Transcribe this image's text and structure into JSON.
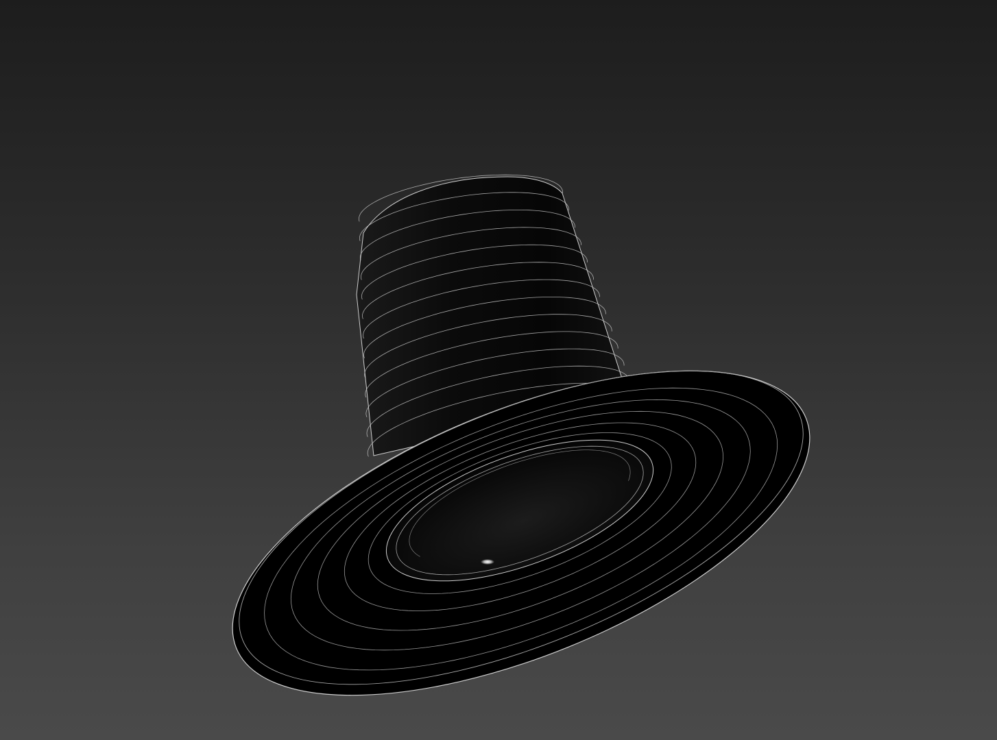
{
  "viewport": {
    "background_top": "#1d1d1d",
    "background_bottom": "#4a4a4a"
  },
  "model": {
    "name_icon": "top-hat-wireframe",
    "surface_color": "#050505",
    "wire_color": "#cfcfcf",
    "highlight_color": "#ffffff"
  }
}
